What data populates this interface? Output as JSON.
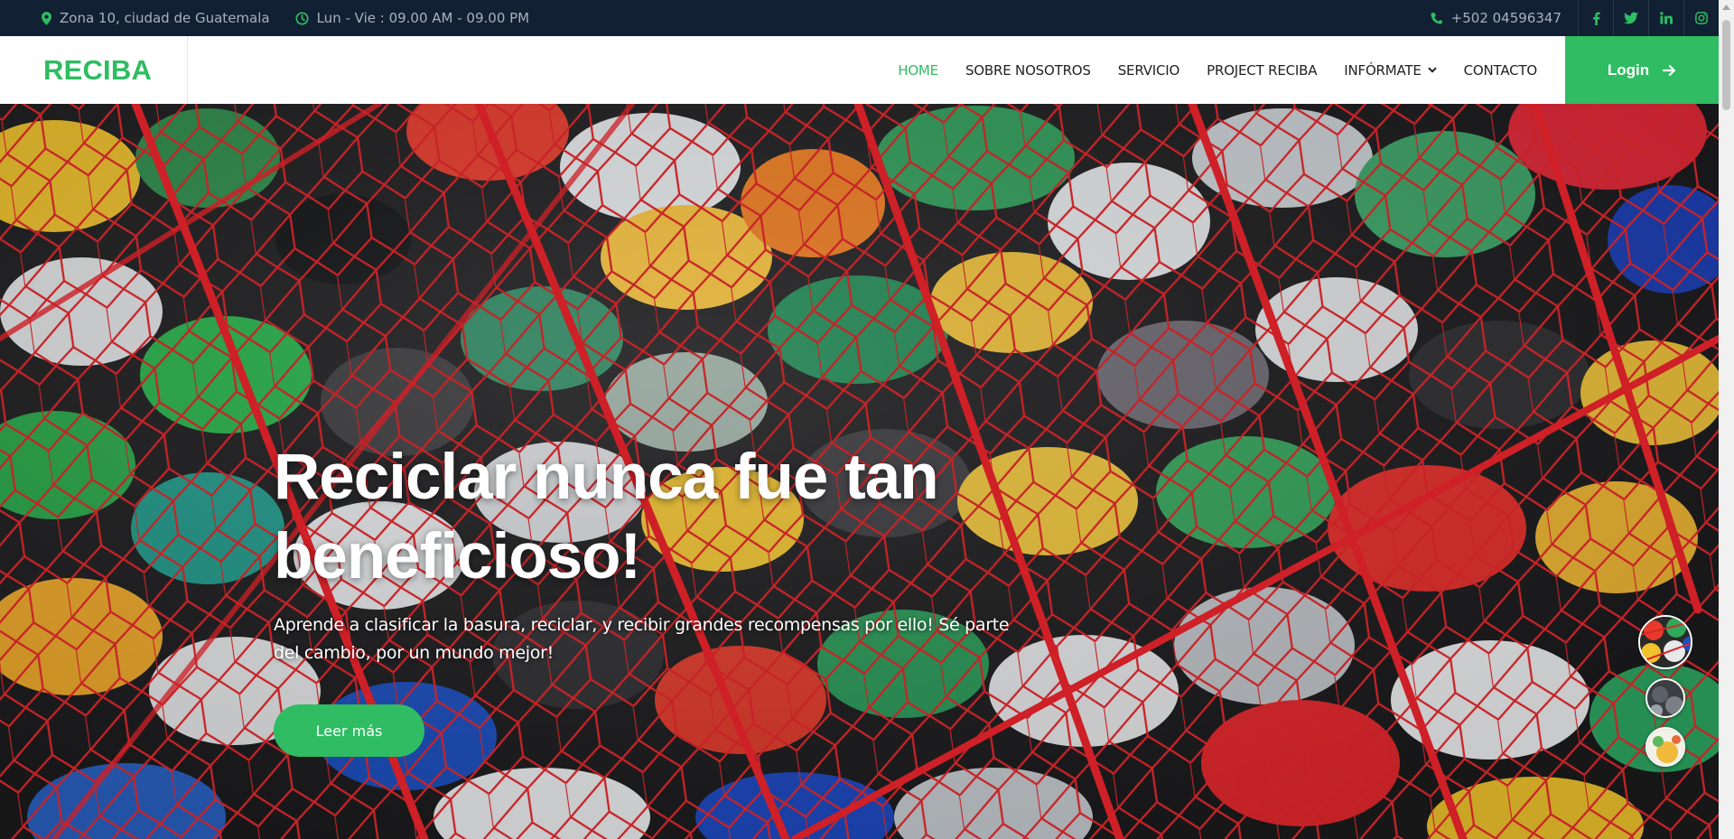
{
  "topbar": {
    "address": "Zona 10, ciudad de Guatemala",
    "hours": "Lun - Vie : 09.00 AM - 09.00 PM",
    "phone": "+502 04596347",
    "social": [
      "facebook-icon",
      "twitter-icon",
      "linkedin-icon",
      "instagram-icon"
    ]
  },
  "brand": {
    "name": "RECIBA"
  },
  "nav": {
    "items": [
      {
        "label": "HOME",
        "active": true
      },
      {
        "label": "SOBRE NOSOTROS"
      },
      {
        "label": "SERVICIO"
      },
      {
        "label": "PROJECT RECIBA"
      },
      {
        "label": "INFÓRMATE",
        "dropdown": true
      },
      {
        "label": "CONTACTO"
      }
    ],
    "login_label": "Login"
  },
  "hero": {
    "title_line1": "Reciclar nunca fue tan",
    "title_line2": "beneficioso!",
    "subtitle": "Aprende a clasificar la basura, reciclar, y recibir grandes recompensas por ello! Sé parte del cambio, por un mundo mejor!",
    "button_label": "Leer más"
  },
  "colors": {
    "accent": "#2fbc62",
    "topbar_bg": "#112033",
    "topbar_text": "#a9b1bb"
  }
}
